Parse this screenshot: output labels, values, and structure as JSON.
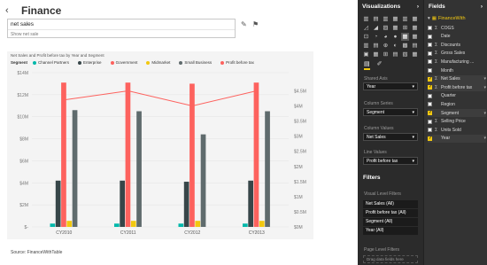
{
  "header": {
    "title": "Finance",
    "back_icon": "chevron-left-icon"
  },
  "qa": {
    "value": "net sales",
    "suggestion": "Show net sale"
  },
  "chart_data": {
    "type": "bar",
    "title": "Net Sales and Profit before tax by Year and Segment",
    "legend_title": "Segment",
    "categories": [
      "CY2010",
      "CY2011",
      "CY2012",
      "CY2013"
    ],
    "series": [
      {
        "name": "Channel Partners",
        "color": "#00b8aa",
        "values": [
          0.3,
          0.3,
          0.3,
          0.3
        ]
      },
      {
        "name": "Enterprise",
        "color": "#374649",
        "values": [
          4.2,
          4.2,
          4.1,
          4.2
        ]
      },
      {
        "name": "Government",
        "color": "#fd625e",
        "values": [
          13.1,
          13.1,
          13.0,
          13.1
        ]
      },
      {
        "name": "Midmarket",
        "color": "#f2c80f",
        "values": [
          0.55,
          0.55,
          0.55,
          0.55
        ]
      },
      {
        "name": "Small Business",
        "color": "#5f6b6d",
        "values": [
          10.6,
          10.5,
          8.4,
          10.5
        ]
      }
    ],
    "line": {
      "name": "Profit before tax",
      "color": "#fd625e",
      "values": [
        4.2,
        4.5,
        4.0,
        4.5
      ]
    },
    "y_left": {
      "ticks": [
        "$14M",
        "$12M",
        "$10M",
        "$8M",
        "$6M",
        "$4M",
        "$2M",
        "$-"
      ],
      "max": 14
    },
    "y_right": {
      "ticks": [
        "$4.5M",
        "$4M",
        "$3.5M",
        "$3M",
        "$2.5M",
        "$2M",
        "$1.5M",
        "$1M",
        "$0.5M",
        "$0M"
      ],
      "max": 5.1
    },
    "grid": true
  },
  "source": "Source: FinanceWithTable",
  "visualizations": {
    "title": "Visualizations",
    "tab_fields_icon": "paint-roller-icon",
    "tab_format_icon": "brush-icon",
    "wells": [
      {
        "label": "Shared Axis",
        "value": "Year"
      },
      {
        "label": "Column Series",
        "value": "Segment"
      },
      {
        "label": "Column Values",
        "value": "Net Sales"
      },
      {
        "label": "Line Values",
        "value": "Profit before tax"
      }
    ],
    "filters_title": "Filters",
    "visual_filters_label": "Visual Level Filters",
    "visual_filters": [
      "Net Sales (All)",
      "Profit before tax (All)",
      "Segment (All)",
      "Year (All)"
    ],
    "page_filters_label": "Page Level Filters",
    "drag_hint": "Drag data fields here"
  },
  "fields": {
    "title": "Fields",
    "table": "FinanceWith",
    "items": [
      {
        "name": "COGS",
        "checked": false,
        "icon": "Σ"
      },
      {
        "name": "Date",
        "checked": false,
        "icon": ""
      },
      {
        "name": "Discounts",
        "checked": false,
        "icon": "Σ"
      },
      {
        "name": "Gross Sales",
        "checked": false,
        "icon": "Σ"
      },
      {
        "name": "Manufacturing ...",
        "checked": false,
        "icon": "Σ"
      },
      {
        "name": "Month",
        "checked": false,
        "icon": ""
      },
      {
        "name": "Net Sales",
        "checked": true,
        "icon": "Σ"
      },
      {
        "name": "Profit before tax",
        "checked": true,
        "icon": "Σ"
      },
      {
        "name": "Quarter",
        "checked": false,
        "icon": ""
      },
      {
        "name": "Region",
        "checked": false,
        "icon": ""
      },
      {
        "name": "Segment",
        "checked": true,
        "icon": ""
      },
      {
        "name": "Selling Price",
        "checked": false,
        "icon": "Σ"
      },
      {
        "name": "Units Sold",
        "checked": false,
        "icon": "Σ"
      },
      {
        "name": "Year",
        "checked": true,
        "icon": ""
      }
    ]
  }
}
